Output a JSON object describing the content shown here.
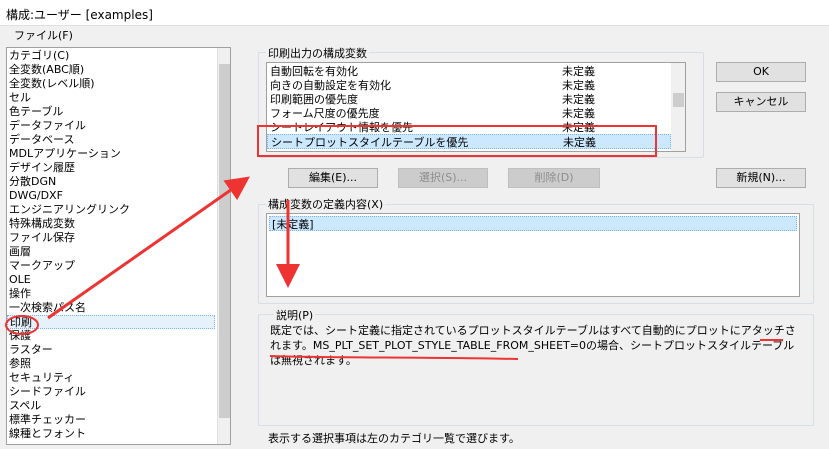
{
  "window": {
    "title": "構成:ユーザー [examples]"
  },
  "menu": {
    "file": "ファイル(F)"
  },
  "categories": [
    "カテゴリ(C)",
    "全変数(ABC順)",
    "全変数(レベル順)",
    "セル",
    "色テーブル",
    "データファイル",
    "データベース",
    "MDLアプリケーション",
    "デザイン履歴",
    "分散DGN",
    "DWG/DXF",
    "エンジニアリングリンク",
    "特殊構成変数",
    "ファイル保存",
    "画層",
    "マークアップ",
    "OLE",
    "操作",
    "一次検索パス名",
    "印刷",
    "保護",
    "ラスター",
    "参照",
    "セキュリティ",
    "シードファイル",
    "スペル",
    "標準チェッカー",
    "線種とフォント"
  ],
  "selected_category": "印刷",
  "variables": {
    "label": "印刷出力の構成変数",
    "rows": [
      {
        "name": "自動回転を有効化",
        "value": "未定義"
      },
      {
        "name": "向きの自動設定を有効化",
        "value": "未定義"
      },
      {
        "name": "印刷範囲の優先度",
        "value": "未定義"
      },
      {
        "name": "フォーム尺度の優先度",
        "value": "未定義"
      },
      {
        "name": "シートレイアウト情報を優先",
        "value": "未定義"
      },
      {
        "name": "シートプロットスタイルテーブルを優先",
        "value": "未定義"
      }
    ],
    "selected_row": "シートプロットスタイルテーブルを優先"
  },
  "buttons": {
    "ok": "OK",
    "cancel": "キャンセル",
    "edit": "編集(E)...",
    "select": "選択(S)...",
    "delete": "削除(D)",
    "new": "新規(N)..."
  },
  "definition": {
    "label": "構成変数の定義内容(X)",
    "value": "[未定義]"
  },
  "description": {
    "label": "説明(P)",
    "text": "既定では、シート定義に指定されているプロットスタイルテーブルはすべて自動的にプロットにアタッチされます。MS_PLT_SET_PLOT_STYLE_TABLE_FROM_SHEET=0の場合、シートプロットスタイルテーブルは無視されます。"
  },
  "footer": "表示する選択事項は左のカテゴリ一覧で選びます。",
  "colors": {
    "annotation": "#ee3333",
    "selection": "#cce8ff"
  }
}
